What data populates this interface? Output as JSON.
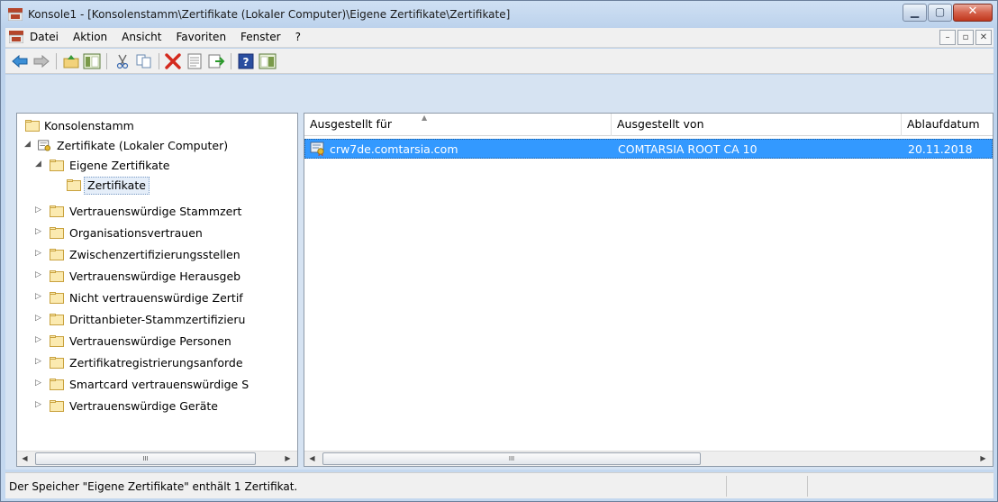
{
  "window": {
    "title": "Konsole1 - [Konsolenstamm\\Zertifikate (Lokaler Computer)\\Eigene Zertifikate\\Zertifikate]"
  },
  "menubar": {
    "items": [
      "Datei",
      "Aktion",
      "Ansicht",
      "Favoriten",
      "Fenster",
      "?"
    ]
  },
  "toolbar": {
    "buttons": [
      "back-icon",
      "forward-icon",
      "up-folder-icon",
      "show-hide-tree-icon",
      "cut-icon",
      "copy-icon",
      "delete-icon",
      "properties-icon",
      "export-icon",
      "help-icon",
      "action-pane-icon"
    ]
  },
  "tree": {
    "items": [
      {
        "label": "Konsolenstamm",
        "expanded": true
      },
      {
        "label": "Zertifikate (Lokaler Computer)",
        "expanded": true
      },
      {
        "label": "Eigene Zertifikate",
        "expanded": true
      },
      {
        "label": "Zertifikate",
        "selected": true
      },
      {
        "label": "Vertrauenswürdige Stammzert"
      },
      {
        "label": "Organisationsvertrauen"
      },
      {
        "label": "Zwischenzertifizierungsstellen"
      },
      {
        "label": "Vertrauenswürdige Herausgeb"
      },
      {
        "label": "Nicht vertrauenswürdige Zertif"
      },
      {
        "label": "Drittanbieter-Stammzertifizieru"
      },
      {
        "label": "Vertrauenswürdige Personen"
      },
      {
        "label": "Zertifikatregistrierungsanforde"
      },
      {
        "label": "Smartcard vertrauenswürdige S"
      },
      {
        "label": "Vertrauenswürdige Geräte"
      }
    ]
  },
  "list": {
    "columns": [
      "Ausgestellt für",
      "Ausgestellt von",
      "Ablaufdatum"
    ],
    "rows": [
      {
        "issued_to": "crw7de.comtarsia.com",
        "issued_by": "COMTARSIA ROOT CA 10",
        "expires": "20.11.2018",
        "selected": true
      }
    ]
  },
  "scrollbar": {
    "thumb_grip": "III"
  },
  "status": {
    "text": "Der Speicher \"Eigene Zertifikate\" enthält 1 Zertifikat."
  },
  "colors": {
    "selection": "#3399ff",
    "close_button": "#c8452e",
    "folder": "#f2d27a"
  }
}
